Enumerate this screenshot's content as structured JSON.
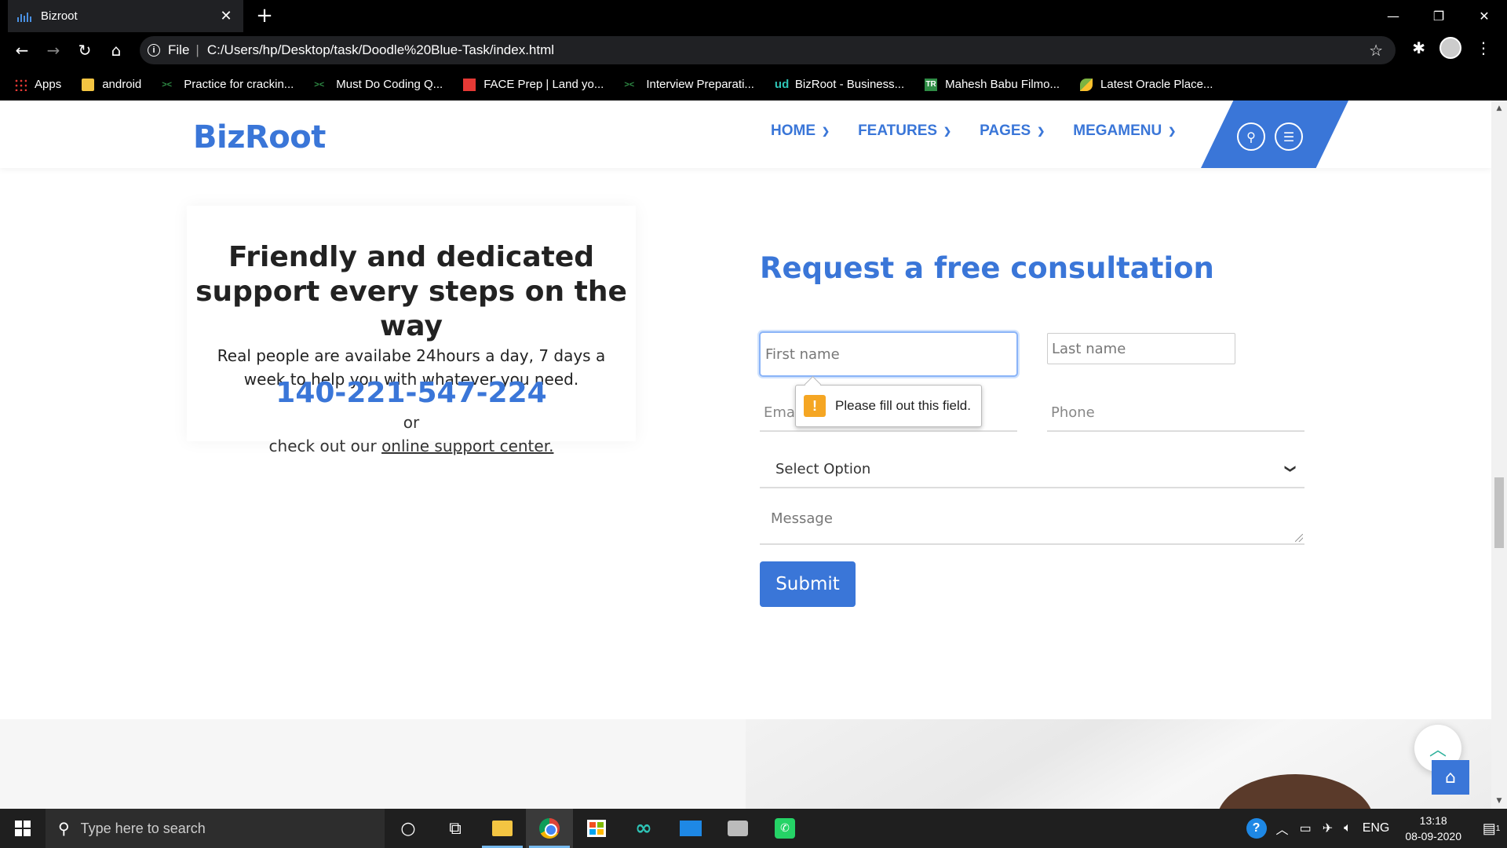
{
  "browser": {
    "tab_title": "Bizroot",
    "tab_close": "✕",
    "new_tab": "+",
    "window_controls": {
      "minimize": "—",
      "restore": "❐",
      "close": "✕"
    },
    "nav": {
      "back": "←",
      "forward": "→",
      "reload": "↻",
      "home": "⌂"
    },
    "address": {
      "scheme_label": "File",
      "separator": "|",
      "url": "C:/Users/hp/Desktop/task/Doodle%20Blue-Task/index.html"
    },
    "bookmarks": [
      "Apps",
      "android",
      "Practice for crackin...",
      "Must Do Coding Q...",
      "FACE Prep | Land yo...",
      "Interview Preparati...",
      "BizRoot - Business...",
      "Mahesh Babu Filmo...",
      "Latest Oracle Place..."
    ]
  },
  "site": {
    "logo": "BizRoot",
    "nav": [
      "HOME",
      "FEATURES",
      "PAGES",
      "MEGAMENU"
    ],
    "accent_color": "#3a76d8"
  },
  "support": {
    "title": "Friendly and dedicated support every steps on the way",
    "text": "Real people are availabe 24hours a day, 7 days a week to help you with whatever you need.",
    "phone": "140-221-547-224",
    "or": "or",
    "link_prefix": "check out our ",
    "link_text": "online support center."
  },
  "form": {
    "title": "Request a free consultation",
    "first_name_placeholder": "First name",
    "last_name_placeholder": "Last name",
    "email_placeholder": "Email",
    "phone_placeholder": "Phone",
    "select_value": "Select Option",
    "message_placeholder": "Message",
    "submit_label": "Submit",
    "validation_message": "Please fill out this field."
  },
  "taskbar": {
    "search_placeholder": "Type here to search",
    "language": "ENG",
    "time": "13:18",
    "date": "08-09-2020",
    "notification_count": "1"
  }
}
